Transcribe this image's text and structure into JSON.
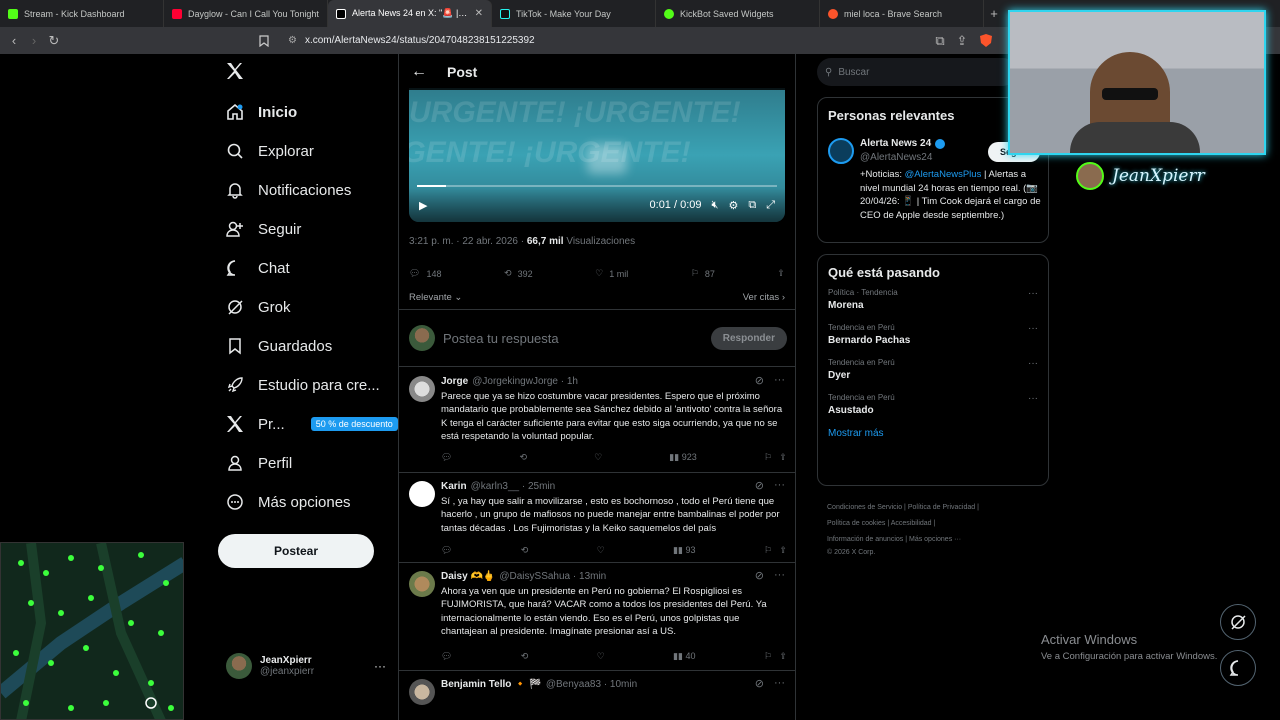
{
  "browser": {
    "tabs": [
      {
        "title": "Stream - Kick Dashboard",
        "color": "#53fc18",
        "active": false
      },
      {
        "title": "Dayglow - Can I Call You Tonight",
        "color": "#ff0033",
        "active": false
      },
      {
        "title": "Alerta News 24 en X: \"🚨 | URGENTE",
        "color": "#ffffff",
        "active": true
      },
      {
        "title": "TikTok - Make Your Day",
        "color": "#ffffff",
        "active": false
      },
      {
        "title": "KickBot Saved Widgets",
        "color": "#53fc18",
        "active": false
      },
      {
        "title": "miel loca - Brave Search",
        "color": "#fb542b",
        "active": false
      }
    ],
    "url": "x.com/AlertaNews24/status/2047048238151225392"
  },
  "nav": {
    "items": [
      {
        "label": "Inicio",
        "icon": "home-icon"
      },
      {
        "label": "Explorar",
        "icon": "search-icon"
      },
      {
        "label": "Notificaciones",
        "icon": "bell-icon"
      },
      {
        "label": "Seguir",
        "icon": "follow-icon"
      },
      {
        "label": "Chat",
        "icon": "chat-icon"
      },
      {
        "label": "Grok",
        "icon": "grok-icon"
      },
      {
        "label": "Guardados",
        "icon": "bookmark-icon"
      },
      {
        "label": "Estudio para cre...",
        "icon": "rocket-icon"
      },
      {
        "label": "Pr...",
        "icon": "x-logo-icon"
      },
      {
        "label": "Perfil",
        "icon": "person-icon"
      },
      {
        "label": "Más opciones",
        "icon": "more-circle-icon"
      }
    ],
    "premium_badge": "50 % de descuento",
    "post_button": "Postear",
    "account": {
      "name": "JeanXpierr",
      "handle": "@jeanxpierr"
    }
  },
  "main": {
    "header": "Post",
    "video": {
      "time": "0:01 / 0:09",
      "watermark": "¡URGENTE! ¡URGENTE!",
      "progress": 0.08
    },
    "meta": {
      "time": "3:21 p. m. · 22 abr. 2026 · ",
      "views": "66,7 mil",
      "views_label": " Visualizaciones"
    },
    "stats": {
      "replies": "148",
      "reposts": "392",
      "likes": "1 mil",
      "bookmarks": "87"
    },
    "relevance": "Relevante",
    "quotes": "Ver citas",
    "reply_placeholder": "Postea tu respuesta",
    "reply_button": "Responder",
    "replies": [
      {
        "name": "Jorge",
        "handle": "@JorgekingwJorge · 1h",
        "text": "Parece que ya se hizo costumbre vacar presidentes. Espero que el próximo mandatario que probablemente sea Sánchez debido al 'antivoto' contra la señora K tenga el carácter suficiente para evitar que esto siga ocurriendo, ya que no se está respetando la voluntad popular.",
        "views": "923"
      },
      {
        "name": "Karin",
        "handle": "@karln3__ · 25min",
        "text": "Sí , ya hay que salir a movilizarse , esto es bochornoso , todo el Perú tiene que hacerlo , un grupo de mafiosos no puede manejar entre bambalinas el poder por tantas décadas . Los Fujimoristas y la Keiko saquemelos del país",
        "views": "93"
      },
      {
        "name": "Daisy 🫶🖕",
        "handle": "@DaisySSahua · 13min",
        "text": "Ahora ya ven que un presidente en Perú no gobierna? El Rospigliosi es FUJIMORISTA, que hará? VACAR como a todos los presidentes del Perú. Ya internacionalmente lo están viendo. Eso es el Perú, unos golpistas que chantajean al presidente. Imagínate presionar así a US.",
        "views": "40"
      },
      {
        "name": "Benjamin Tello 🔸 🏁",
        "handle": "@Benyaa83 · 10min",
        "text": "",
        "views": ""
      }
    ]
  },
  "right": {
    "search_placeholder": "Buscar",
    "relevant": {
      "title": "Personas relevantes",
      "name": "Alerta News 24",
      "handle": "@AlertaNews24",
      "follow": "Seguir",
      "bio_prefix": "+Noticias: ",
      "bio_link": "@AlertaNewsPlus",
      "bio_rest": " | Alertas a nivel mundial 24 horas en tiempo real. (📷 20/04/26: 📱 | Tim Cook dejará el cargo de CEO de Apple desde septiembre.)"
    },
    "trends": {
      "title": "Qué está pasando",
      "items": [
        {
          "category": "Política · Tendencia",
          "name": "Morena"
        },
        {
          "category": "Tendencia en Perú",
          "name": "Bernardo Pachas"
        },
        {
          "category": "Tendencia en Perú",
          "name": "Dyer"
        },
        {
          "category": "Tendencia en Perú",
          "name": "Asustado"
        }
      ],
      "more": "Mostrar más"
    },
    "footer": [
      "Condiciones de Servicio",
      "Política de Privacidad",
      "Política de cookies",
      "Accesibilidad",
      "Información de anuncios",
      "Más opciones ···",
      "© 2026 X Corp."
    ]
  },
  "overlay": {
    "streamer_name": "JeanXpierr",
    "windows_title": "Activar Windows",
    "windows_sub": "Ve a Configuración para activar Windows."
  },
  "colors": {
    "accent": "#1d9bf0",
    "cyan": "#2fd5ef"
  }
}
